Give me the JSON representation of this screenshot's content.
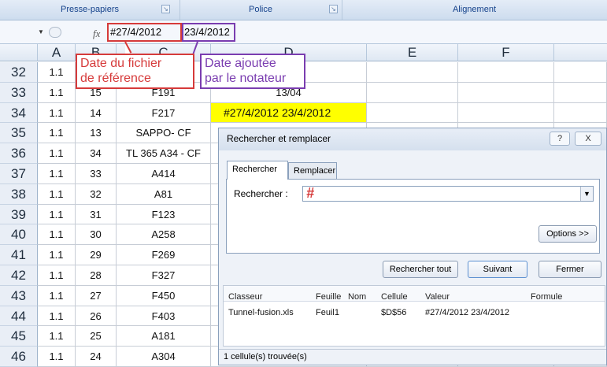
{
  "ribbon": {
    "groups": [
      "Presse-papiers",
      "Police",
      "Alignement"
    ]
  },
  "formula_bar": {
    "fx_label": "fx",
    "value_part1": "#27/4/2012",
    "value_part2": "23/4/2012"
  },
  "columns": [
    "A",
    "B",
    "C",
    "D",
    "E",
    "F"
  ],
  "rows": [
    {
      "num": "32",
      "a": "1.1",
      "b": "",
      "c": "",
      "d": ""
    },
    {
      "num": "33",
      "a": "1.1",
      "b": "15",
      "c": "F191",
      "d": "13/04"
    },
    {
      "num": "34",
      "a": "1.1",
      "b": "14",
      "c": "F217",
      "d": "#27/4/2012 23/4/2012"
    },
    {
      "num": "35",
      "a": "1.1",
      "b": "13",
      "c": "SAPPO- CF",
      "d": ""
    },
    {
      "num": "36",
      "a": "1.1",
      "b": "34",
      "c": "TL 365 A34 - CF",
      "d": ""
    },
    {
      "num": "37",
      "a": "1.1",
      "b": "33",
      "c": "A414",
      "d": ""
    },
    {
      "num": "38",
      "a": "1.1",
      "b": "32",
      "c": "A81",
      "d": ""
    },
    {
      "num": "39",
      "a": "1.1",
      "b": "31",
      "c": "F123",
      "d": ""
    },
    {
      "num": "40",
      "a": "1.1",
      "b": "30",
      "c": "A258",
      "d": ""
    },
    {
      "num": "41",
      "a": "1.1",
      "b": "29",
      "c": "F269",
      "d": ""
    },
    {
      "num": "42",
      "a": "1.1",
      "b": "28",
      "c": "F327",
      "d": ""
    },
    {
      "num": "43",
      "a": "1.1",
      "b": "27",
      "c": "F450",
      "d": ""
    },
    {
      "num": "44",
      "a": "1.1",
      "b": "26",
      "c": "F403",
      "d": ""
    },
    {
      "num": "45",
      "a": "1.1",
      "b": "25",
      "c": "A181",
      "d": ""
    },
    {
      "num": "46",
      "a": "1.1",
      "b": "24",
      "c": "A304",
      "d": ""
    }
  ],
  "annotations": {
    "red_line1": "Date du fichier",
    "red_line2": "de référence",
    "purple_line1": "Date ajoutée",
    "purple_line2": "par le notateur",
    "red_color": "#d63a3a",
    "purple_color": "#7a3db0"
  },
  "highlight_color": "#ffff00",
  "dialog": {
    "title": "Rechercher et remplacer",
    "help_button": "?",
    "close_button": "X",
    "tab_find": "Rechercher",
    "tab_replace": "Remplacer",
    "find_label": "Rechercher :",
    "find_value": "#",
    "options_button": "Options >>",
    "find_all_button": "Rechercher tout",
    "next_button": "Suivant",
    "close_dialog_button": "Fermer",
    "results_headers": [
      "Classeur",
      "Feuille",
      "Nom",
      "Cellule",
      "Valeur",
      "Formule"
    ],
    "results_row": {
      "classeur": "Tunnel-fusion.xls",
      "feuille": "Feuil1",
      "nom": "",
      "cellule": "$D$56",
      "valeur": "#27/4/2012 23/4/2012",
      "formule": ""
    },
    "status": "1 cellule(s) trouvée(s)"
  }
}
